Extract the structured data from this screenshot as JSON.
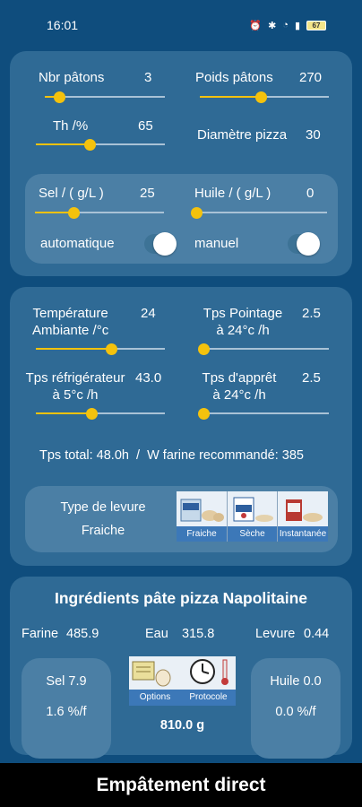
{
  "status_bar": {
    "time": "16:01",
    "battery": "67"
  },
  "params": {
    "nbr_patons": {
      "label": "Nbr pâtons",
      "value": "3",
      "level": 0.12
    },
    "poids_patons": {
      "label": "Poids pâtons",
      "value": "270",
      "level": 0.47
    },
    "th": {
      "label": "Th /%",
      "value": "65",
      "level": 0.42
    },
    "diametre": {
      "label": "Diamètre pizza",
      "value": "30"
    }
  },
  "salt_oil": {
    "sel": {
      "label": "Sel / ( g/L )",
      "value": "25",
      "level": 0.3
    },
    "huile": {
      "label": "Huile / ( g/L )",
      "value": "0",
      "level": 0.0
    },
    "mode_left": "automatique",
    "mode_right": "manuel"
  },
  "fermentation": {
    "temperature": {
      "label_line1": "Température",
      "label_line2": "Ambiante /°c",
      "value": "24",
      "level": 0.58
    },
    "tps_pointage": {
      "label_line1": "Tps Pointage",
      "label_line2": "à 24°c /h",
      "value": "2.5",
      "level": 0.03
    },
    "tps_refrigerateur": {
      "label_line1": "Tps réfrigérateur",
      "label_line2": "à 5°c /h",
      "value": "43.0",
      "level": 0.43
    },
    "tps_appret": {
      "label_line1": "Tps d'apprêt",
      "label_line2": "à 24°c /h",
      "value": "2.5",
      "level": 0.03
    },
    "summary": "Tps total: 48.0h  /  W farine recommandé: 385"
  },
  "yeast": {
    "title": "Type de levure",
    "selected": "Fraiche",
    "options": [
      "Fraiche",
      "Sèche",
      "Instantanée"
    ]
  },
  "ingredients": {
    "title": "Ingrédients pâte pizza Napolitaine",
    "farine": {
      "label": "Farine",
      "value": "485.9"
    },
    "eau": {
      "label": "Eau",
      "value": "315.8"
    },
    "levure": {
      "label": "Levure",
      "value": "0.44"
    },
    "sel": {
      "line1": "Sel 7.9",
      "line2": "1.6 %/f"
    },
    "huile": {
      "line1": "Huile 0.0",
      "line2": "0.0 %/f"
    },
    "buttons": [
      "Options",
      "Protocole"
    ],
    "total": "810.0 g"
  },
  "footer": {
    "title": "Empâtement direct"
  },
  "colors": {
    "background": "#0f4d7d",
    "card": "#2f6a95",
    "inner_card": "#4b7fa5",
    "slider_accent": "#f4c20d",
    "button_caption": "#3c78b8"
  }
}
